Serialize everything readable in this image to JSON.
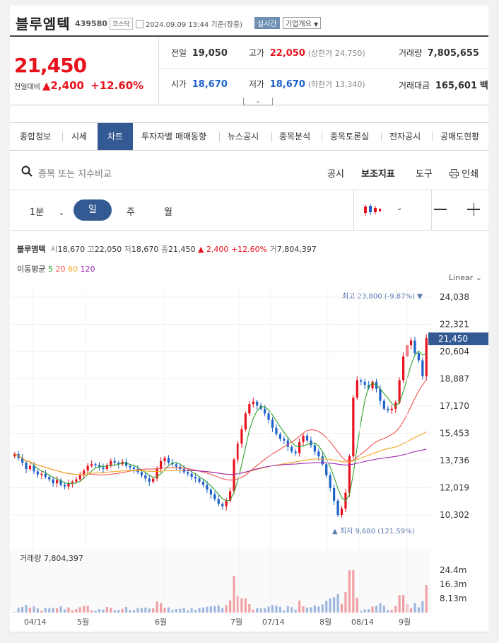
{
  "header": {
    "name": "블루엠텍",
    "code": "439580",
    "market": "코스닥",
    "datetime": "2024.09.09 13:44 기준(장중)",
    "realtime_badge": "실시간",
    "corp_info": "기업개요"
  },
  "quote": {
    "price": "21,450",
    "change_label": "전일대비",
    "change": "▲2,400",
    "change_pct": "+12.60%",
    "prev_close_label": "전일",
    "prev_close": "19,050",
    "high_label": "고가",
    "high": "22,050",
    "upper_limit": "(상한가 24,750)",
    "volume_label": "거래량",
    "volume": "7,805,655",
    "open_label": "시가",
    "open": "18,670",
    "low_label": "저가",
    "low": "18,670",
    "lower_limit": "(하한가 13,340)",
    "amount_label": "거래대금",
    "amount": "165,601",
    "amount_unit": "백만"
  },
  "tabs": [
    "종합정보",
    "시세",
    "차트",
    "투자자별 매매동향",
    "뉴스공시",
    "종목분석",
    "종목토론실",
    "전자공시",
    "공매도현황"
  ],
  "active_tab": "차트",
  "search": {
    "placeholder": "종목 또는 지수비교",
    "buttons": [
      "공시",
      "보조지표",
      "도구",
      "인쇄"
    ]
  },
  "controls": {
    "interval": "1분",
    "periods": [
      "일",
      "주",
      "월"
    ],
    "active_period": "일"
  },
  "chart_info": {
    "name": "블루엠텍",
    "open_label": "시",
    "open": "18,670",
    "high_label": "고",
    "high": "22,050",
    "low_label": "저",
    "low": "18,670",
    "close_label": "종",
    "close": "21,450",
    "change": "▲ 2,400 +12.60%",
    "volume_label": "거",
    "volume": "7,804,397",
    "ma_label": "이동평균",
    "ma_periods": [
      "5",
      "20",
      "60",
      "120"
    ],
    "ma_colors": [
      "#2ca02c",
      "#ef5350",
      "#f5a623",
      "#9c27b0"
    ],
    "scale": "Linear",
    "volume_title": "거래량 7,804,397"
  },
  "chart_data": {
    "type": "candlestick",
    "y_ticks": [
      "24,038",
      "22,321",
      "20,604",
      "18,887",
      "17,170",
      "15,453",
      "13,736",
      "12,019",
      "10,302"
    ],
    "y_tick_values": [
      24038,
      22321,
      20604,
      18887,
      17170,
      15453,
      13736,
      12019,
      10302
    ],
    "current_price": "21,450",
    "max_label": "최고 23,800 (-9.87%)",
    "min_label": "최저 9,680 (121.59%)",
    "x_labels": [
      "04/14",
      "5월",
      "6월",
      "7월",
      "07/14",
      "8월",
      "08/14",
      "9월"
    ],
    "volume_ticks": [
      "24.4m",
      "16.3m",
      "8.13m"
    ],
    "volume_tick_values": [
      24.4,
      16.3,
      8.13
    ],
    "close": [
      14150,
      13900,
      13600,
      13200,
      13400,
      13050,
      12850,
      12900,
      12700,
      12550,
      12300,
      12500,
      12200,
      12100,
      12300,
      12400,
      12550,
      12800,
      13100,
      13400,
      13500,
      13450,
      13300,
      13200,
      13450,
      13700,
      13600,
      13500,
      13650,
      13400,
      13300,
      13200,
      13000,
      12800,
      12600,
      12400,
      12600,
      13200,
      13700,
      13900,
      13600,
      13500,
      13350,
      13200,
      13000,
      12900,
      12700,
      12600,
      12400,
      12200,
      11900,
      11600,
      11300,
      11000,
      10850,
      11200,
      11800,
      13800,
      14800,
      15700,
      16700,
      17300,
      17450,
      17200,
      17000,
      16700,
      16300,
      15800,
      15400,
      15100,
      15000,
      14600,
      14300,
      14200,
      14900,
      15300,
      15000,
      14700,
      14300,
      14000,
      13500,
      12800,
      12000,
      11200,
      10300,
      10700,
      11700,
      14000,
      17700,
      18800,
      18700,
      18500,
      18300,
      18700,
      18250,
      17500,
      17000,
      16900,
      17000,
      17400,
      18800,
      20300,
      21000,
      21300,
      20500,
      20050,
      19050,
      21450
    ]
  }
}
